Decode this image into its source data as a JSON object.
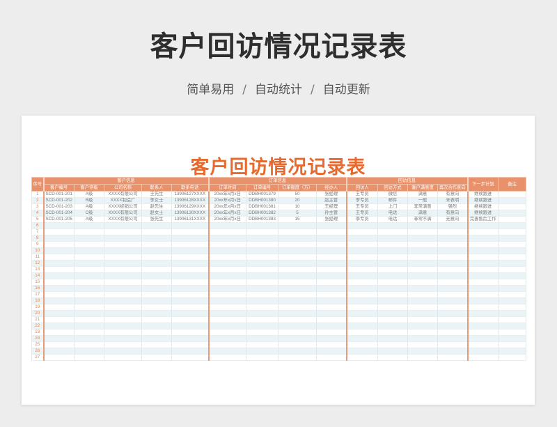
{
  "banner": {
    "title": "客户回访情况记录表",
    "subtitle": [
      "简单易用",
      "自动统计",
      "自动更新"
    ],
    "separator": "/"
  },
  "sheet": {
    "title": "客户回访情况记录表",
    "header_groups": {
      "index": "序号",
      "customer": "客户信息",
      "order": "订单信息",
      "visit": "回访信息",
      "next": "下一步计划",
      "remark": "备注"
    },
    "columns": [
      "客户编号",
      "客户评级",
      "公司名称",
      "联系人",
      "联系电话",
      "订单时间",
      "订单编号",
      "订单额度（万）",
      "经办人",
      "回访人",
      "回访方式",
      "客户满意度",
      "再次合作意向"
    ],
    "rows": [
      [
        "1",
        "SCD-001-201",
        "A级",
        "XXXX有限公司",
        "王先生",
        "13906127XXXX",
        "20xx年x月x日",
        "DDBH001379",
        "50",
        "张经理",
        "王专员",
        "微信",
        "满意",
        "有意向",
        "继续跟进",
        ""
      ],
      [
        "2",
        "SCD-001-202",
        "B级",
        "XXXX制造厂",
        "李女士",
        "13906128XXXX",
        "20xx年x月x日",
        "DDBH001380",
        "20",
        "赵主管",
        "李专员",
        "邮件",
        "一般",
        "未表明",
        "继续跟进",
        ""
      ],
      [
        "3",
        "SCD-001-203",
        "A级",
        "XXXX经销公司",
        "赵先生",
        "13906129XXXX",
        "20xx年x月x日",
        "DDBH001381",
        "10",
        "王经理",
        "王专员",
        "上门",
        "非常满意",
        "强烈",
        "继续跟进",
        ""
      ],
      [
        "4",
        "SCD-001-204",
        "C级",
        "XXXX有限公司",
        "赵女士",
        "13906130XXXX",
        "20xx年x月x日",
        "DDBH001382",
        "5",
        "孙主管",
        "王专员",
        "电话",
        "满意",
        "有意向",
        "继续跟进",
        ""
      ],
      [
        "5",
        "SCD-001-205",
        "A级",
        "XXXX有限公司",
        "张先生",
        "13906131XXXX",
        "20xx年x月x日",
        "DDBH001383",
        "15",
        "张经理",
        "李专员",
        "电话",
        "非常不满",
        "无意向",
        "完善售后工作",
        ""
      ]
    ],
    "empty_row_numbers": [
      "6",
      "7",
      "8",
      "9",
      "10",
      "11",
      "12",
      "13",
      "14",
      "15",
      "16",
      "17",
      "18",
      "19",
      "20",
      "21",
      "22",
      "23",
      "24",
      "25",
      "26",
      "27"
    ]
  }
}
